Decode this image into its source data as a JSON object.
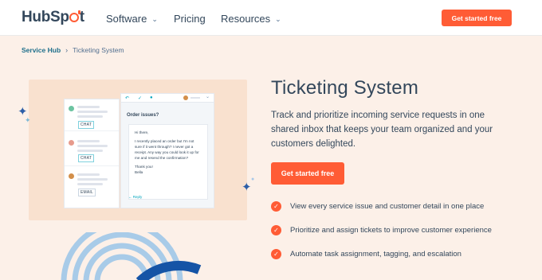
{
  "header": {
    "logo": "HubSpot",
    "nav": [
      {
        "label": "Software",
        "has_dropdown": true
      },
      {
        "label": "Pricing",
        "has_dropdown": false
      },
      {
        "label": "Resources",
        "has_dropdown": true
      }
    ],
    "cta_label": "Get started free"
  },
  "breadcrumb": {
    "parent": "Service Hub",
    "current": "Ticketing System"
  },
  "illustration": {
    "tags": [
      "CHAT",
      "CHAT",
      "EMAIL"
    ],
    "ticket_title": "Order issues?",
    "message": {
      "greeting": "Hi there,",
      "body": "I recently placed an order but I'm not sure if it went through? I never got a receipt. Any way you could look it up for me and resend the confirmation?",
      "signoff": "Thank you!",
      "name": "Bella"
    },
    "reply_label": "Reply"
  },
  "main": {
    "title": "Ticketing System",
    "description": "Track and prioritize incoming service requests in one shared inbox that keeps your team organized and your customers delighted.",
    "cta_label": "Get started free",
    "features": [
      "View every service issue and customer detail in one place",
      "Prioritize and assign tickets to improve customer experience",
      "Automate task assignment, tagging, and escalation"
    ]
  },
  "colors": {
    "accent": "#ff5c35",
    "background": "#fcf0e8",
    "text": "#33475b",
    "link": "#1f6f8b"
  }
}
